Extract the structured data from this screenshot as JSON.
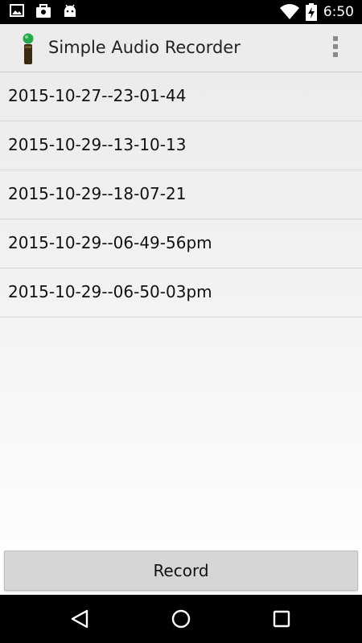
{
  "status_bar": {
    "time": "6:50",
    "left_icons": [
      "image-icon",
      "briefcase-icon",
      "android-icon"
    ],
    "right_icons": [
      "wifi-icon",
      "battery-charging-icon"
    ]
  },
  "action_bar": {
    "title": "Simple Audio Recorder",
    "app_icon": "microphone-icon",
    "menu_icon": "overflow-menu-icon"
  },
  "recordings": [
    {
      "label": "2015-10-27--23-01-44"
    },
    {
      "label": "2015-10-29--13-10-13"
    },
    {
      "label": "2015-10-29--18-07-21"
    },
    {
      "label": "2015-10-29--06-49-56pm"
    },
    {
      "label": "2015-10-29--06-50-03pm"
    }
  ],
  "record_button": {
    "label": "Record"
  },
  "nav_bar": {
    "icons": [
      "back-icon",
      "home-icon",
      "recents-icon"
    ]
  },
  "colors": {
    "status_bar": "#000000",
    "action_bar": "#ececec",
    "button": "#d6d6d6",
    "mic_head": "#27a84a"
  }
}
